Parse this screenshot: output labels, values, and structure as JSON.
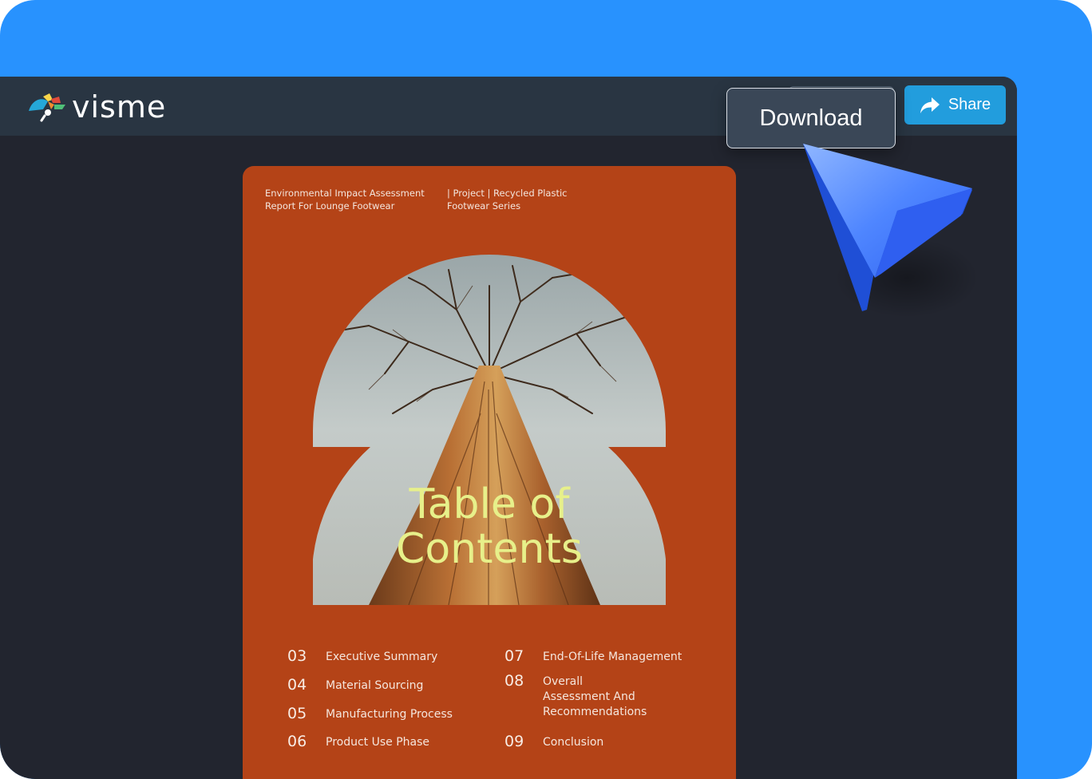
{
  "app": {
    "logo_text": "visme",
    "share_label": "Share",
    "download_label": "Download"
  },
  "document": {
    "header_left": "Environmental Impact Assessment Report For Lounge Footwear",
    "header_right": "| Project | Recycled Plastic Footwear Series",
    "title_line1": "Table of",
    "title_line2": "Contents",
    "toc_left": [
      {
        "num": "03",
        "label": "Executive Summary"
      },
      {
        "num": "04",
        "label": "Material Sourcing"
      },
      {
        "num": "05",
        "label": "Manufacturing Process"
      },
      {
        "num": "06",
        "label": "Product Use Phase"
      }
    ],
    "toc_right": [
      {
        "num": "07",
        "label": "End-Of-Life Management"
      },
      {
        "num": "08",
        "label_lines": [
          "Overall",
          "Assessment And",
          "Recommendations"
        ]
      },
      {
        "num": "09",
        "label": "Conclusion"
      }
    ]
  },
  "colors": {
    "background_blue": "#2892fe",
    "app_bg": "#22252f",
    "topbar_bg": "#293542",
    "share_button": "#229ddd",
    "doc_orange": "#b44317",
    "title_yellow": "#e7f08a"
  },
  "icons": [
    "visme-logo-icon",
    "share-arrow-icon",
    "cursor-pointer-icon"
  ]
}
